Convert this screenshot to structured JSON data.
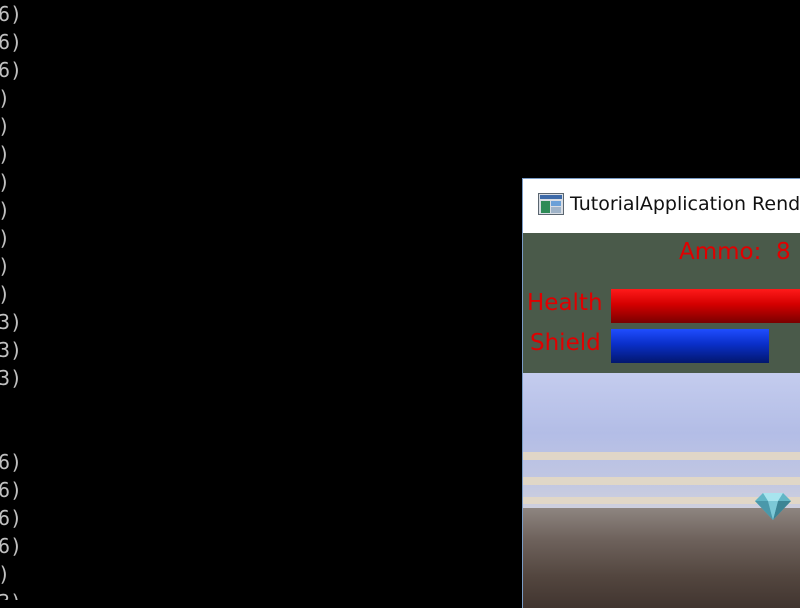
{
  "console": {
    "lines": [
      "6)",
      "6)",
      "6)",
      ")",
      ")",
      ")",
      ")",
      ")",
      ")",
      ")",
      ")",
      "3)",
      "3)",
      "3)",
      "",
      "",
      "6)",
      "6)",
      "6)",
      "6)",
      ")",
      "3)"
    ]
  },
  "window": {
    "title": "TutorialApplication Rende",
    "icon": "app-window-icon"
  },
  "hud": {
    "ammo_text": "Ammo:  8",
    "health_label": "Health",
    "shield_label": "Shield",
    "colors": {
      "text": "#e00000",
      "health": "#d40000",
      "shield": "#0a2fc8",
      "panel": "#4a5a4a"
    }
  },
  "scene": {
    "object_icon": "diamond-gem-icon"
  }
}
